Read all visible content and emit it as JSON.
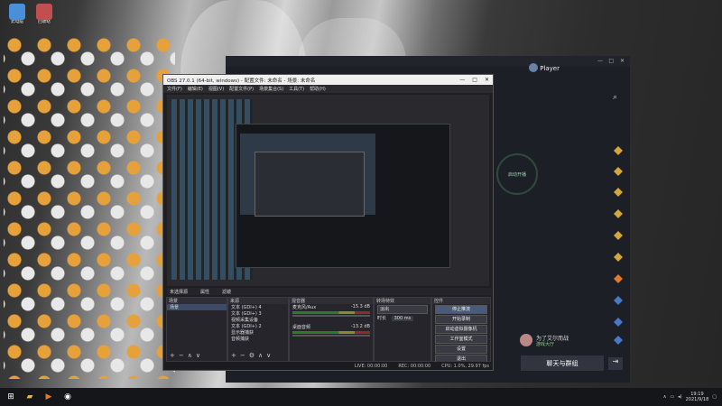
{
  "desktop": {
    "icons": [
      {
        "label": "此电脑",
        "color": "#4a90d9"
      },
      {
        "label": "回收站",
        "color": "#c05050"
      },
      {
        "label": "",
        "color": "#d8d8d8"
      },
      {
        "label": "",
        "color": "#d8d8d8"
      },
      {
        "label": "",
        "color": "#d8d8d8"
      },
      {
        "label": "",
        "color": "#d8d8d8"
      },
      {
        "label": "",
        "color": "#d8d8d8"
      },
      {
        "label": "",
        "color": "#d8d8d8"
      }
    ]
  },
  "obs": {
    "title": "OBS 27.0.1 (64-bit, windows) - 配置文件: 未命名 - 场景: 未命名",
    "menu": [
      "文件(F)",
      "编辑(E)",
      "视图(V)",
      "配置文件(P)",
      "场景集合(S)",
      "工具(T)",
      "帮助(H)"
    ],
    "context_bar": {
      "source": "未选择源",
      "props": "属性",
      "filters": "滤镜"
    },
    "docks": {
      "scenes": {
        "title": "场景",
        "items": [
          "场景"
        ]
      },
      "sources": {
        "title": "来源",
        "items": [
          "文本 (GDI+) 4",
          "文本 (GDI+) 3",
          "视频采集设备",
          "文本 (GDI+) 2",
          "显示器捕获",
          "音频捕获"
        ]
      },
      "mixer": {
        "title": "混音器",
        "items": [
          {
            "name": "麦克风/Aux",
            "db": "-15.3 dB"
          },
          {
            "name": "桌面音频",
            "db": "-13.2 dB"
          }
        ]
      },
      "transitions": {
        "title": "转场特效",
        "type": "淡出",
        "duration_label": "时长",
        "duration": "300 ms"
      },
      "controls": {
        "title": "控件",
        "buttons": [
          "停止推流",
          "开始录制",
          "启动虚拟摄像机",
          "工作室模式",
          "设置",
          "退出"
        ]
      }
    },
    "status": {
      "live": "LIVE: 00:00:00",
      "rec": "REC: 00:00:00",
      "cpu": "CPU: 1.0%, 29.97 fps"
    }
  },
  "platform": {
    "player_name": "Player",
    "start_live": "启动开播",
    "chat_button": "聊天与群组",
    "friend": {
      "name": "为了艾尔而战",
      "status": "游戏大厅"
    }
  },
  "taskbar": {
    "time": "19:19",
    "date": "2021/9/18"
  }
}
